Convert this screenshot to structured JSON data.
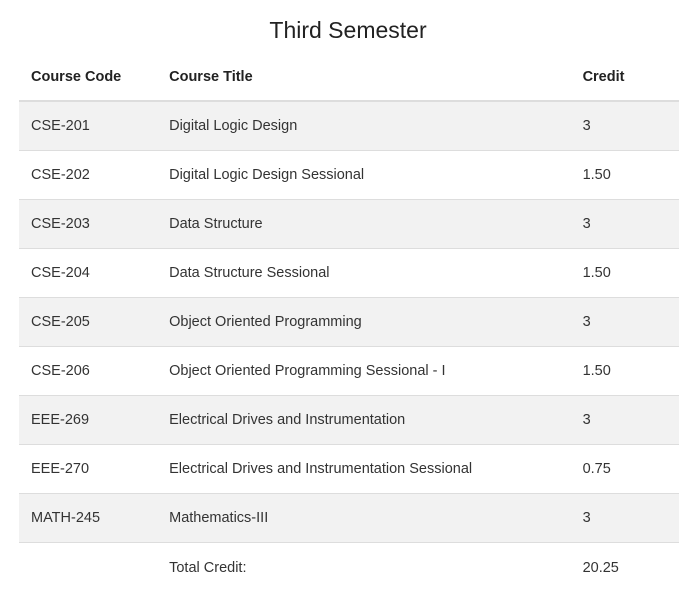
{
  "page": {
    "title": "Third Semester"
  },
  "table": {
    "headers": {
      "code": "Course Code",
      "title": "Course Title",
      "credit": "Credit"
    },
    "rows": [
      {
        "code": "CSE-201",
        "title": "Digital Logic Design",
        "credit": "3"
      },
      {
        "code": "CSE-202",
        "title": "Digital Logic Design Sessional",
        "credit": "1.50"
      },
      {
        "code": "CSE-203",
        "title": "Data Structure",
        "credit": "3"
      },
      {
        "code": "CSE-204",
        "title": "Data Structure Sessional",
        "credit": "1.50"
      },
      {
        "code": "CSE-205",
        "title": "Object Oriented Programming",
        "credit": "3"
      },
      {
        "code": "CSE-206",
        "title": "Object Oriented Programming Sessional - I",
        "credit": "1.50"
      },
      {
        "code": "EEE-269",
        "title": "Electrical Drives and Instrumentation",
        "credit": "3"
      },
      {
        "code": "EEE-270",
        "title": "Electrical Drives and Instrumentation Sessional",
        "credit": "0.75"
      },
      {
        "code": "MATH-245",
        "title": "Mathematics-III",
        "credit": "3"
      }
    ],
    "total": {
      "label": "Total Credit:",
      "value": "20.25"
    }
  },
  "colors": {
    "stripe": "#f2f2f2",
    "border": "#dddddd",
    "text": "#333333"
  }
}
